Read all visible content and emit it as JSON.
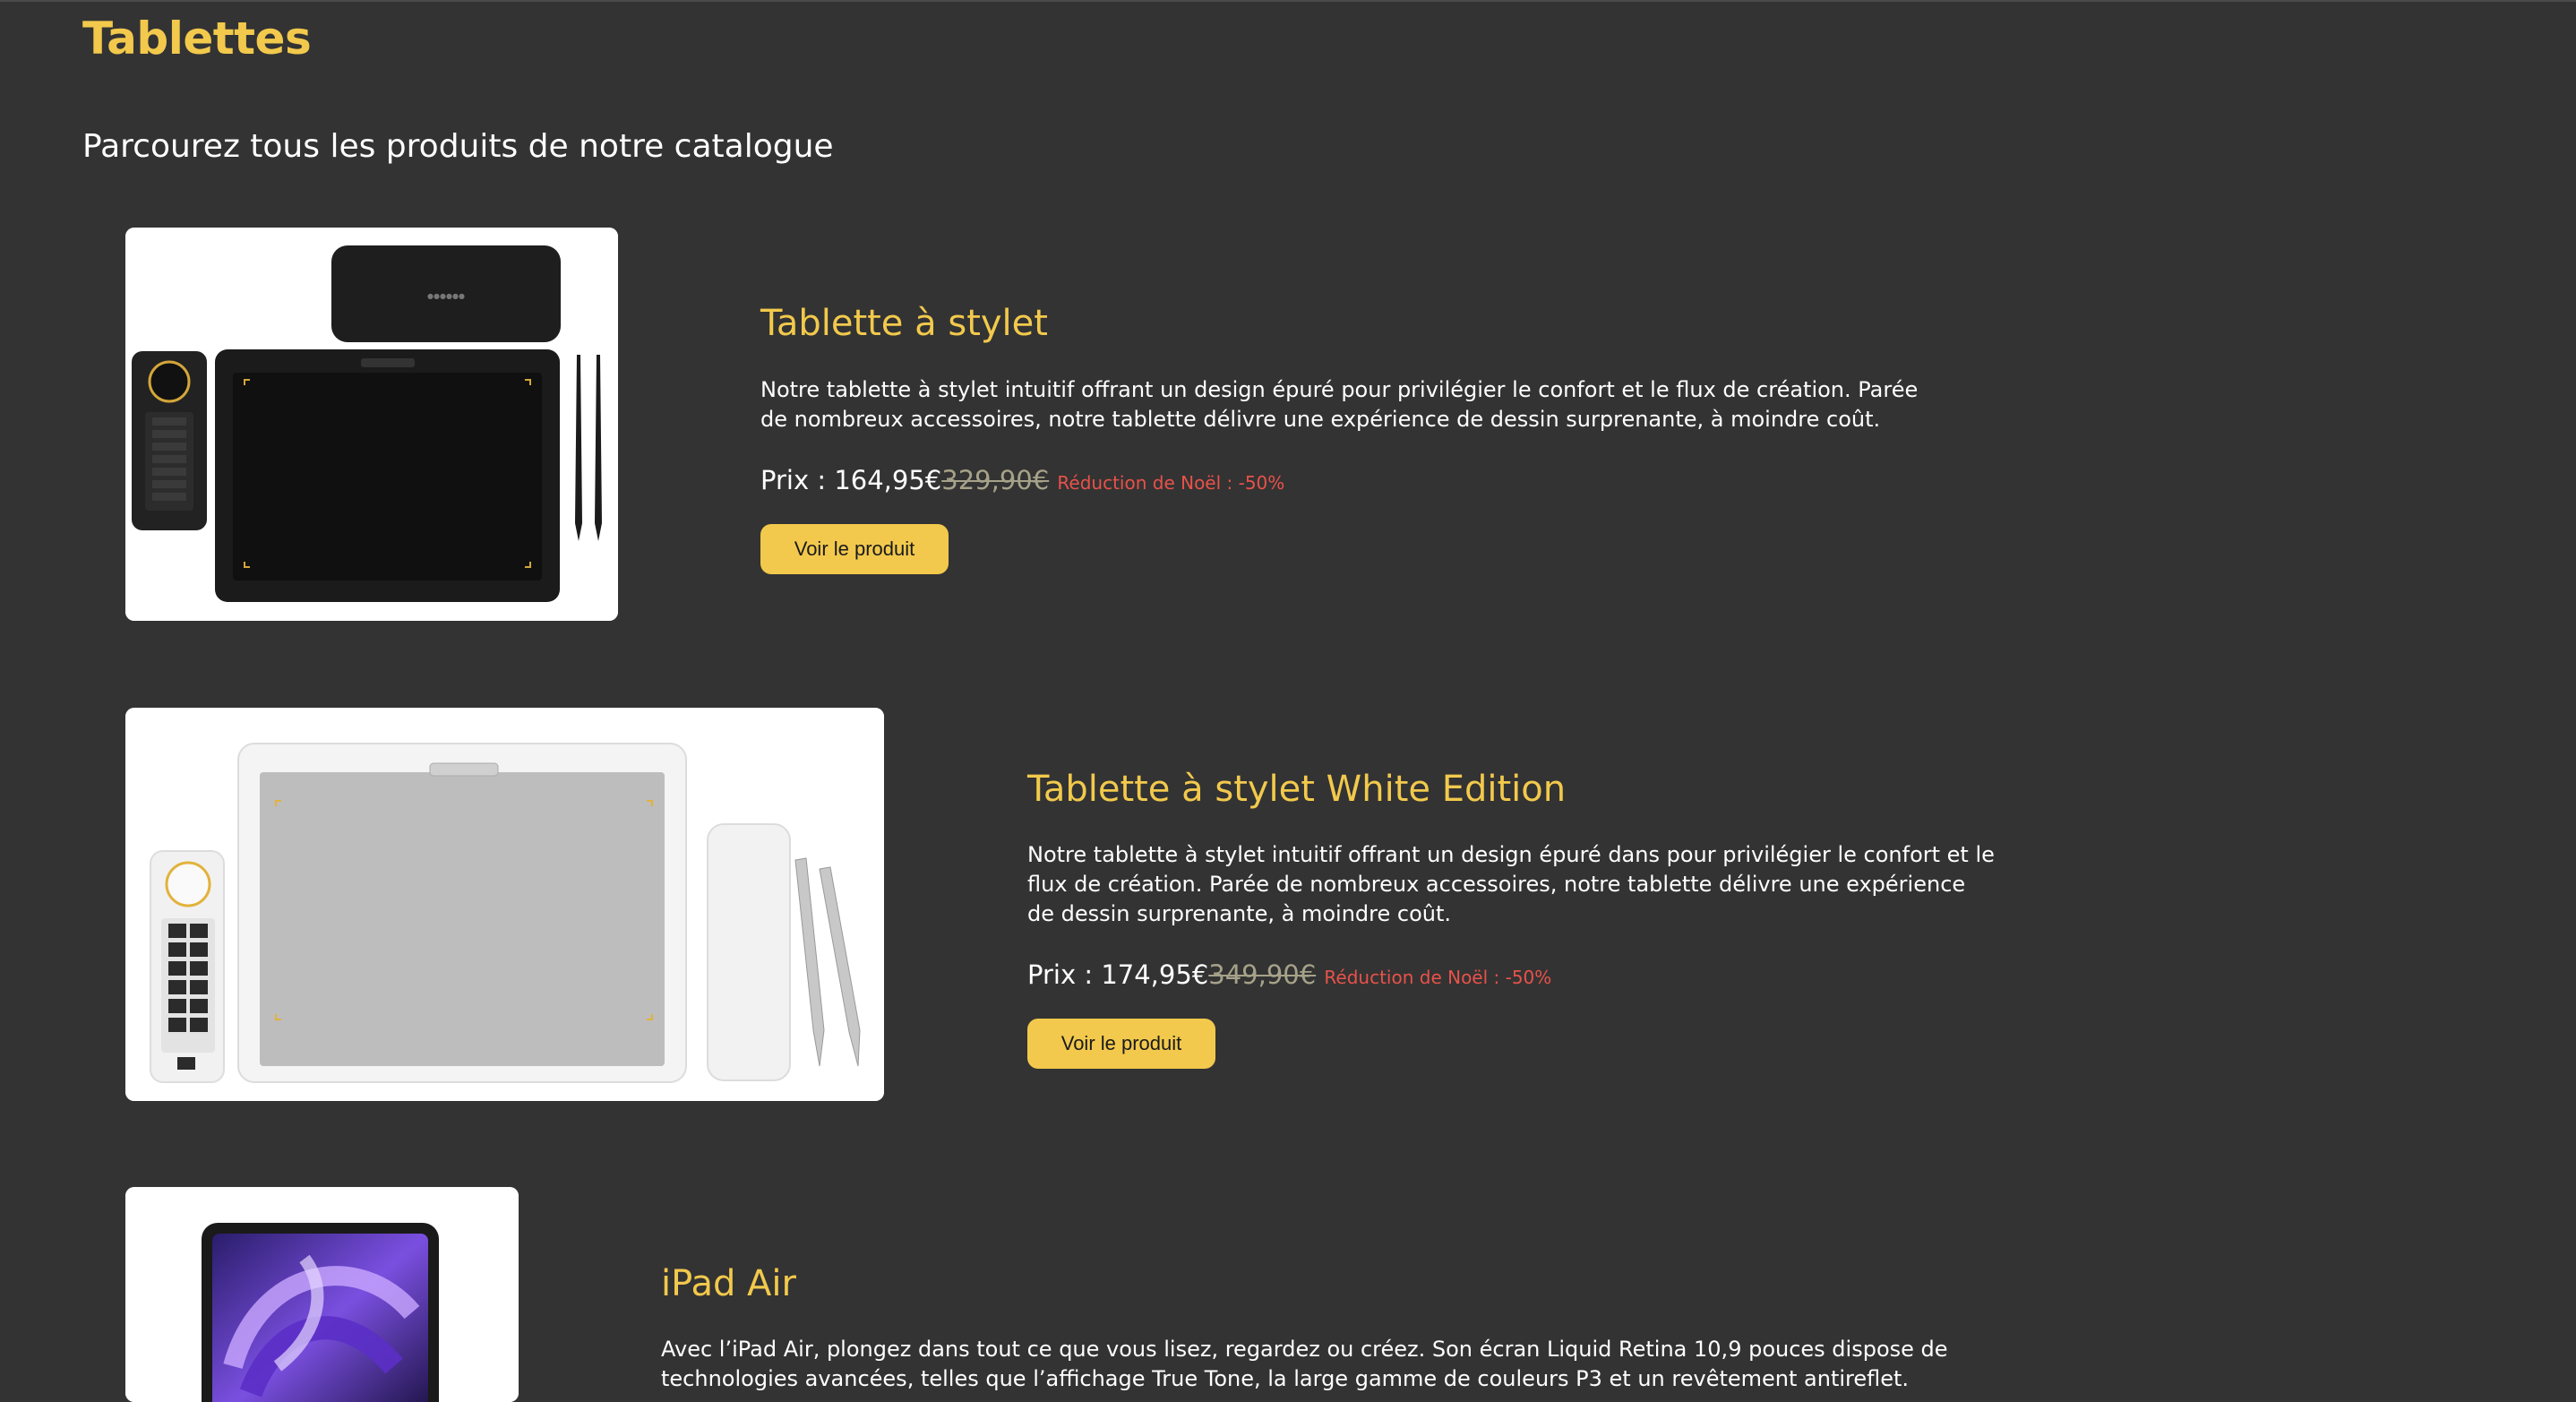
{
  "page": {
    "title": "Tablettes",
    "subtitle": "Parcourez tous les produits de notre catalogue"
  },
  "colors": {
    "background": "#333333",
    "accent": "#f2c94c",
    "discount": "#e8524a",
    "old_price": "#a6a289"
  },
  "products": [
    {
      "title": "Tablette à stylet",
      "description": "Notre tablette à stylet intuitif offrant un design épuré pour privilégier le confort et le flux de création. Parée de nombreux accessoires, notre tablette délivre une expérience de dessin surprenante, à moindre coût.",
      "price_label": "Prix : 164,95€",
      "old_price": "329,90€",
      "discount": "Réduction de Noël : -50%",
      "button_label": "Voir le produit",
      "image_icon": "black-drawing-tablet-image"
    },
    {
      "title": "Tablette à stylet White Edition",
      "description": "Notre tablette à stylet intuitif offrant un design épuré dans pour privilégier le confort et le flux de création. Parée de nombreux accessoires, notre tablette délivre une expérience de dessin surprenante, à moindre coût.",
      "price_label": "Prix : 174,95€",
      "old_price": "349,90€",
      "discount": "Réduction de Noël : -50%",
      "button_label": "Voir le produit",
      "image_icon": "white-drawing-tablet-image"
    },
    {
      "title": "iPad Air",
      "description": "Avec l’iPad Air, plongez dans tout ce que vous lisez, regardez ou créez. Son écran Liquid Retina 10,9 pouces dispose de technologies avancées, telles que l’affichage True Tone, la large gamme de couleurs P3 et un revêtement antireflet.",
      "image_icon": "ipad-air-image"
    }
  ]
}
